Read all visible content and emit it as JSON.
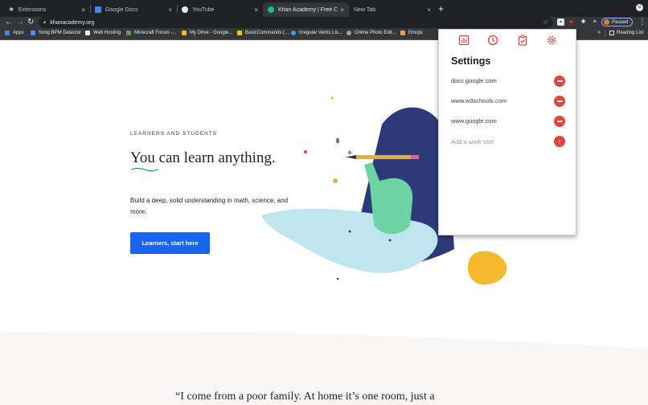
{
  "browser": {
    "tabs": [
      {
        "title": "Extensions",
        "active": false
      },
      {
        "title": "Google Docs",
        "active": false
      },
      {
        "title": "YouTube",
        "active": false
      },
      {
        "title": "Khan Academy | Free Online C",
        "active": true
      },
      {
        "title": "New Tab",
        "active": false
      }
    ],
    "close_glyph": "×",
    "new_tab_glyph": "+",
    "url": "khanacademy.org",
    "profile_status": "Paused",
    "bookmarks": [
      {
        "label": "Apps",
        "color": "#4285f4"
      },
      {
        "label": "Song BPM Detector",
        "color": "#4a8df8"
      },
      {
        "label": "Web Hosting",
        "color": "#e8eaed"
      },
      {
        "label": "Minecraft Forum -...",
        "color": "#5b9e3f"
      },
      {
        "label": "My Drive - Google...",
        "color": "#fbbc04"
      },
      {
        "label": "BasicCommands (...",
        "color": "#f4c20d"
      },
      {
        "label": "Irregular Verbs Lis...",
        "color": "#3e9ee8"
      },
      {
        "label": "Online Photo Edit...",
        "color": "#9aa0a6"
      },
      {
        "label": "Emojis",
        "color": "#f2994a"
      }
    ],
    "bookmarks_overflow": "»",
    "reading_list": "Reading List"
  },
  "page": {
    "eyebrow": "LEARNERS AND STUDENTS",
    "headline": "You can learn anything.",
    "lede": "Build a deep, solid understanding in math, science, and more.",
    "cta_label": "Learners, start here",
    "quote": "“I come from a poor family. At home it’s one room, just a"
  },
  "popup": {
    "title": "Settings",
    "tabs": [
      "chart-icon",
      "clock-icon",
      "clipboard-icon",
      "gear-icon"
    ],
    "accent": "#e0443e",
    "sites": [
      "docs.google.com",
      "www.w3schools.com",
      "www.google.com"
    ],
    "add_placeholder": "Add a work site!"
  }
}
